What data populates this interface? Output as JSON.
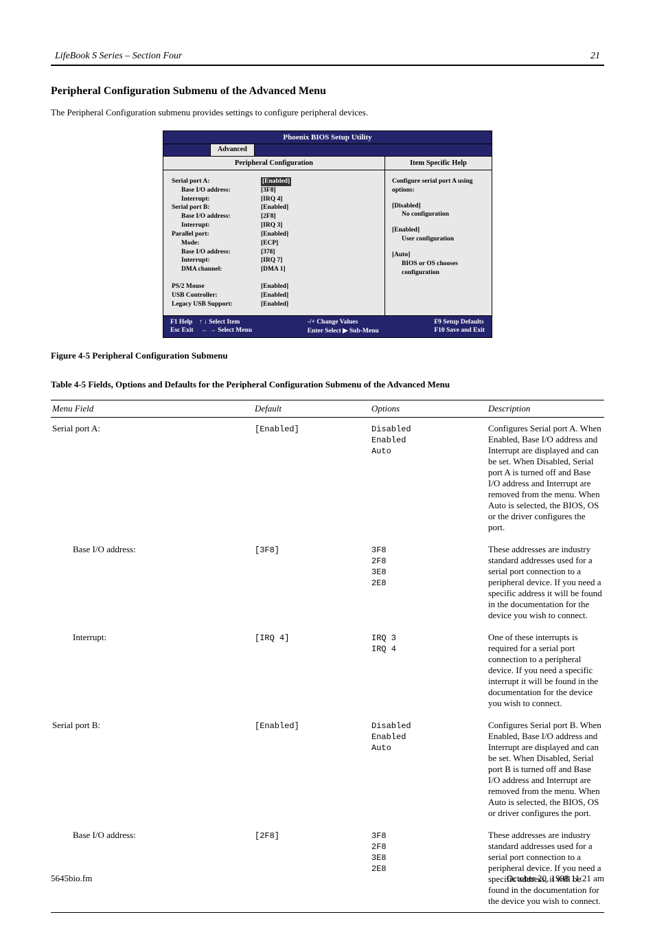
{
  "header": {
    "left": "LifeBook S Series – Section Four",
    "right": "21"
  },
  "section_heading": "Peripheral Configuration Submenu of the Advanced Menu",
  "section_intro": "The Peripheral Configuration submenu provides settings to configure peripheral devices.",
  "bios": {
    "title": "Phoenix BIOS Setup Utility",
    "tab": "Advanced",
    "left_heading": "Peripheral Configuration",
    "right_heading": "Item Specific Help",
    "rows": [
      {
        "label": "Serial port A:",
        "value": "[Enabled]",
        "indent": false,
        "selected": true
      },
      {
        "label": "Base I/O address:",
        "value": "[3F8]",
        "indent": true
      },
      {
        "label": "Interrupt:",
        "value": "[IRQ 4]",
        "indent": true
      },
      {
        "label": "Serial port B:",
        "value": "[Enabled]",
        "indent": false
      },
      {
        "label": "Base I/O address:",
        "value": "[2F8]",
        "indent": true
      },
      {
        "label": "Interrupt:",
        "value": "[IRQ 3]",
        "indent": true
      },
      {
        "label": "Parallel port:",
        "value": "[Enabled]",
        "indent": false
      },
      {
        "label": "Mode:",
        "value": "[ECP]",
        "indent": true
      },
      {
        "label": "Base I/O address:",
        "value": "[378]",
        "indent": true
      },
      {
        "label": "Interrupt:",
        "value": "[IRQ 7]",
        "indent": true
      },
      {
        "label": "DMA channel:",
        "value": "[DMA 1]",
        "indent": true
      }
    ],
    "rows2": [
      {
        "label": "PS/2 Mouse",
        "value": "[Enabled]"
      },
      {
        "label": "USB Controller:",
        "value": "[Enabled]"
      },
      {
        "label": "Legacy USB Support:",
        "value": "[Enabled]"
      }
    ],
    "help": {
      "intro": "Configure serial port A using options:",
      "opts": [
        {
          "head": "[Disabled]",
          "body": "No configuration"
        },
        {
          "head": "[Enabled]",
          "body": "User configuration"
        },
        {
          "head": "[Auto]",
          "body": "BIOS or OS chooses configuration"
        }
      ]
    },
    "footer": {
      "l1": "F1   Help",
      "l2": "Esc  Exit",
      "m1": "↑ ↓   Select Item",
      "m2": "← →   Select Menu",
      "r1": "-/+    Change Values",
      "r2": "Enter  Select  ▶ Sub-Menu",
      "e1": "F9    Setup Defaults",
      "e2": "F10  Save and Exit"
    }
  },
  "figure_caption": "Figure 4-5 Peripheral Configuration Submenu",
  "table": {
    "caption": "Table 4-5 Fields, Options and Defaults for the Peripheral Configuration Submenu of the Advanced Menu",
    "headers": {
      "menu": "Menu Field",
      "default": "Default",
      "options": "Options",
      "description": "Description"
    },
    "rows": [
      {
        "menu": "Serial port A:",
        "default": "[Enabled]",
        "options": "Disabled<br>Enabled<br>Auto",
        "description": "Configures Serial port A. When Enabled, Base I/O address and Interrupt are displayed and can be set. When Disabled, Serial port A is turned off and Base I/O address and Interrupt are removed from the menu. When Auto is selected, the BIOS, OS or the driver configures the port.",
        "indent": false
      },
      {
        "menu": "Base I/O address:",
        "default": "[3F8]",
        "options": "3F8<br>2F8<br>3E8<br>2E8",
        "description": "These addresses are industry standard addresses used for a serial port connection to a peripheral device. If you need a specific address it will be found in the documentation for the device you wish to connect.",
        "indent": true
      },
      {
        "menu": "Interrupt:",
        "default": "[IRQ 4]",
        "options": "IRQ 3<br>IRQ 4",
        "description": "One of these interrupts is required for a serial port connection to a peripheral device. If you need a specific interrupt it will be found in the documentation for the device you wish to connect.",
        "indent": true
      },
      {
        "menu": "Serial port B:",
        "default": "[Enabled]",
        "options": "Disabled<br>Enabled<br>Auto",
        "description": "Configures Serial port B. When Enabled, Base I/O address and Interrupt are displayed and can be set. When Disabled, Serial port B is turned off and Base I/O address and Interrupt are removed from the menu. When Auto is selected, the BIOS, OS or driver configures the port.",
        "indent": false
      },
      {
        "menu": "Base I/O address:",
        "default": "[2F8]",
        "options": "3F8<br>2F8<br>3E8<br>2E8",
        "description": "These addresses are industry standard addresses used for a serial port connection to a peripheral device. If you need a specific address, it will be found in the documentation for the device you wish to connect.",
        "indent": true
      }
    ]
  },
  "footer_left": "5645bio.fm",
  "footer_right": "October 20, 1998 11:21 am"
}
